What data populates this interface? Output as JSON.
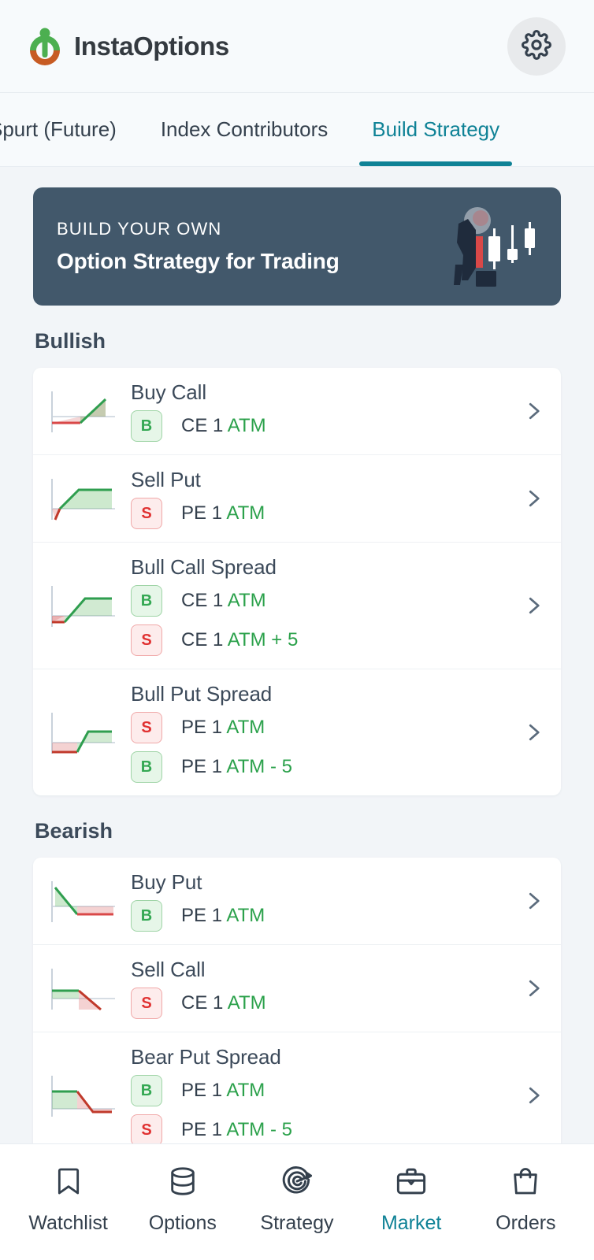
{
  "colors": {
    "accent_teal": "#0f8296",
    "banner_bg": "#42586b",
    "page_bg": "#f2f5f8",
    "header_bg": "#f7fafc",
    "text_dark": "#34404d",
    "buy_green": "#34a853",
    "sell_red": "#e03131",
    "strike_green": "#2ba14b",
    "logo_green": "#4caf50",
    "logo_orange": "#c75b23"
  },
  "header": {
    "brand_name": "InstaOptions",
    "logo_icon": "instaoptions-logo-icon",
    "settings_icon": "gear-icon"
  },
  "tabs": [
    {
      "label": "Spurt (Future)",
      "active": false
    },
    {
      "label": "Index Contributors",
      "active": false
    },
    {
      "label": "Build Strategy",
      "active": true
    }
  ],
  "banner": {
    "kicker": "BUILD YOUR OWN",
    "title": "Option Strategy for Trading",
    "art_icon": "trader-candlestick-illustration"
  },
  "sections": [
    {
      "title": "Bullish",
      "strategies": [
        {
          "name": "Buy Call",
          "payoff_icon": "payoff-buy-call",
          "chevron_icon": "chevron-right-icon",
          "legs": [
            {
              "action": "B",
              "type": "buy",
              "instrument": "CE",
              "qty": "1",
              "strike": "ATM"
            }
          ]
        },
        {
          "name": "Sell Put",
          "payoff_icon": "payoff-sell-put",
          "chevron_icon": "chevron-right-icon",
          "legs": [
            {
              "action": "S",
              "type": "sell",
              "instrument": "PE",
              "qty": "1",
              "strike": "ATM"
            }
          ]
        },
        {
          "name": "Bull Call Spread",
          "payoff_icon": "payoff-bull-call-spread",
          "chevron_icon": "chevron-right-icon",
          "legs": [
            {
              "action": "B",
              "type": "buy",
              "instrument": "CE",
              "qty": "1",
              "strike": "ATM"
            },
            {
              "action": "S",
              "type": "sell",
              "instrument": "CE",
              "qty": "1",
              "strike": "ATM + 5"
            }
          ]
        },
        {
          "name": "Bull Put Spread",
          "payoff_icon": "payoff-bull-put-spread",
          "chevron_icon": "chevron-right-icon",
          "legs": [
            {
              "action": "S",
              "type": "sell",
              "instrument": "PE",
              "qty": "1",
              "strike": "ATM"
            },
            {
              "action": "B",
              "type": "buy",
              "instrument": "PE",
              "qty": "1",
              "strike": "ATM - 5"
            }
          ]
        }
      ]
    },
    {
      "title": "Bearish",
      "strategies": [
        {
          "name": "Buy Put",
          "payoff_icon": "payoff-buy-put",
          "chevron_icon": "chevron-right-icon",
          "legs": [
            {
              "action": "B",
              "type": "buy",
              "instrument": "PE",
              "qty": "1",
              "strike": "ATM"
            }
          ]
        },
        {
          "name": "Sell Call",
          "payoff_icon": "payoff-sell-call",
          "chevron_icon": "chevron-right-icon",
          "legs": [
            {
              "action": "S",
              "type": "sell",
              "instrument": "CE",
              "qty": "1",
              "strike": "ATM"
            }
          ]
        },
        {
          "name": "Bear Put Spread",
          "payoff_icon": "payoff-bear-put-spread",
          "chevron_icon": "chevron-right-icon",
          "legs": [
            {
              "action": "B",
              "type": "buy",
              "instrument": "PE",
              "qty": "1",
              "strike": "ATM"
            },
            {
              "action": "S",
              "type": "sell",
              "instrument": "PE",
              "qty": "1",
              "strike": "ATM - 5"
            }
          ]
        }
      ]
    }
  ],
  "bottom_nav": [
    {
      "label": "Watchlist",
      "icon": "bookmark-icon",
      "active": false
    },
    {
      "label": "Options",
      "icon": "database-icon",
      "active": false
    },
    {
      "label": "Strategy",
      "icon": "target-arrow-icon",
      "active": false
    },
    {
      "label": "Market",
      "icon": "briefcase-icon",
      "active": true
    },
    {
      "label": "Orders",
      "icon": "shopping-bag-icon",
      "active": false
    }
  ]
}
